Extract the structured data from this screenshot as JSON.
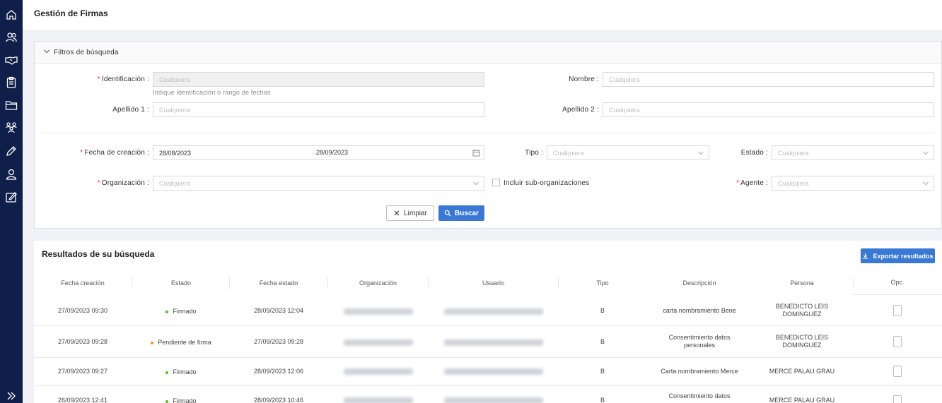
{
  "page": {
    "title": "Gestión de Firmas"
  },
  "sidebar": {
    "icons": [
      "home-icon",
      "users-icon",
      "handshake-icon",
      "clipboard-icon",
      "folder-icon",
      "team-icon",
      "pen-icon",
      "user-icon",
      "signature-icon"
    ],
    "expand_icon": "double-chevron-right-icon"
  },
  "filters": {
    "title": "Filtros de búsqueda",
    "identificacion": {
      "label": "Identificación :",
      "placeholder": "Cualquiera",
      "hint": "Indique identificación o rango de fechas"
    },
    "nombre": {
      "label": "Nombre :",
      "placeholder": "Cualquiera"
    },
    "apellido1": {
      "label": "Apellido 1 :",
      "placeholder": "Cualquiera"
    },
    "apellido2": {
      "label": "Apellido 2 :",
      "placeholder": "Cualquiera"
    },
    "fecha_creacion": {
      "label": "Fecha de creación :",
      "from": "28/08/2023",
      "to": "28/09/2023",
      "separator": "→"
    },
    "tipo": {
      "label": "Tipo :",
      "placeholder": "Cualquiera"
    },
    "estado": {
      "label": "Estado :",
      "placeholder": "Cualquiera"
    },
    "organizacion": {
      "label": "Organización :",
      "placeholder": "Cualquiera"
    },
    "sub_organizaciones": {
      "label": "Incluir sub-organizaciones",
      "checked": false
    },
    "agente": {
      "label": "Agente :",
      "placeholder": "Cualquiera"
    },
    "clear_label": "Limpiar",
    "search_label": "Buscar"
  },
  "results": {
    "title": "Resultados de su búsqueda",
    "export_label": "Exportar resultados",
    "columns": [
      "Fecha creación",
      "Estado",
      "Fecha estado",
      "Organización",
      "Usuario",
      "Tipo",
      "Descripción",
      "Persona",
      "Opc."
    ],
    "rows": [
      {
        "fecha_creacion": "27/09/2023 09:30",
        "estado": "Firmado",
        "estado_color": "#52c41a",
        "fecha_estado": "28/09/2023 12:04",
        "tipo": "B",
        "descripcion": "carta nombramiento Bene",
        "persona": "BENEDICTO LEIS DOMINGUEZ"
      },
      {
        "fecha_creacion": "27/09/2023 09:28",
        "estado": "Pendiente de firma",
        "estado_color": "#fa8c16",
        "fecha_estado": "27/09/2023 09:28",
        "tipo": "B",
        "descripcion": "Consentimiento datos personales",
        "persona": "BENEDICTO LEIS DOMINGUEZ"
      },
      {
        "fecha_creacion": "27/09/2023 09:27",
        "estado": "Firmado",
        "estado_color": "#52c41a",
        "fecha_estado": "28/09/2023 12:06",
        "tipo": "B",
        "descripcion": "Carta nombramiento Merce",
        "persona": "MERCE PALAU GRAU"
      },
      {
        "fecha_creacion": "26/09/2023 12:41",
        "estado": "Firmado",
        "estado_color": "#52c41a",
        "fecha_estado": "28/09/2023 10:46",
        "tipo": "B",
        "descripcion": "Consentimiento datos",
        "persona": "MERCE PALAU GRAU"
      }
    ]
  }
}
